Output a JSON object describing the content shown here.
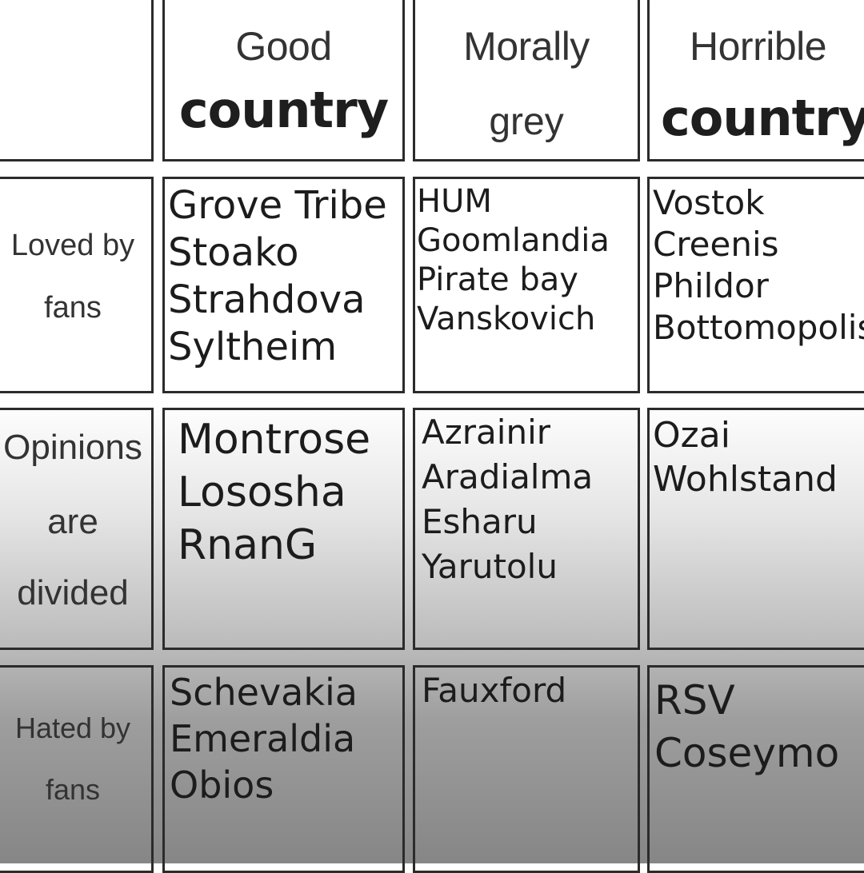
{
  "columns": [
    {
      "top": "Good",
      "bottom": "country"
    },
    {
      "top": "Morally",
      "bottom": "grey"
    },
    {
      "top": "Horrible",
      "bottom": "country"
    }
  ],
  "rows": [
    {
      "label_lines": [
        "Loved by",
        "fans"
      ]
    },
    {
      "label_lines": [
        "Opinions",
        "are",
        "divided"
      ]
    },
    {
      "label_lines": [
        "Hated by",
        "fans"
      ]
    }
  ],
  "cells": {
    "loved_good": [
      "Grove Tribe",
      "Stoako",
      "Strahdova",
      "Syltheim"
    ],
    "loved_grey": [
      "HUM",
      "Goomlandia",
      "Pirate bay",
      "Vanskovich"
    ],
    "loved_horrible": [
      "Vostok",
      "Creenis",
      "Phildor",
      "Bottomopolis"
    ],
    "divided_good": [
      "Montrose",
      "Lososha",
      "RnanG"
    ],
    "divided_grey": [
      "Azrainir",
      "Aradialma",
      "Esharu",
      "Yarutolu"
    ],
    "divided_horrible": [
      "Ozai",
      "Wohlstand"
    ],
    "hated_good": [
      "Schevakia",
      "Emeraldia",
      "Obios"
    ],
    "hated_grey": [
      "Fauxford"
    ],
    "hated_horrible": [
      "RSV",
      "Coseymo"
    ]
  }
}
